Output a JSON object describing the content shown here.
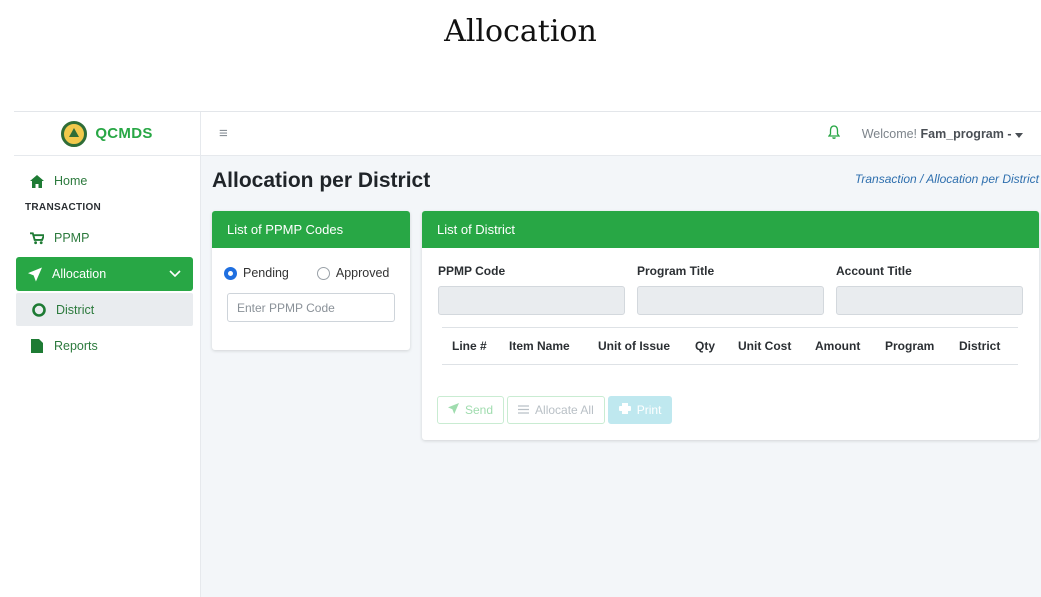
{
  "caption": "Allocation",
  "brand": {
    "name": "QCMDS"
  },
  "sidebar": {
    "home": "Home",
    "section": "TRANSACTION",
    "ppmp": "PPMP",
    "allocation": "Allocation",
    "district": "District",
    "reports": "Reports"
  },
  "topbar": {
    "welcome": "Welcome!",
    "user": "Fam_program -"
  },
  "page": {
    "title": "Allocation per District",
    "breadcrumb": "Transaction / Allocation per District"
  },
  "left_card": {
    "title": "List of PPMP Codes",
    "pending": "Pending",
    "approved": "Approved",
    "selected": "Pending",
    "placeholder": "Enter PPMP Code"
  },
  "right_card": {
    "title": "List of District",
    "fields": [
      "PPMP Code",
      "Program Title",
      "Account Title"
    ],
    "columns": [
      "Line #",
      "Item Name",
      "Unit of Issue",
      "Qty",
      "Unit Cost",
      "Amount",
      "Program",
      "District"
    ],
    "buttons": {
      "send": "Send",
      "allocate": "Allocate All",
      "print": "Print"
    }
  },
  "colors": {
    "accent": "#28a745",
    "breadcrumb": "#2e6fae",
    "radio": "#1f6fe0"
  },
  "icons": [
    "home-icon",
    "cart-icon",
    "paper-plane-icon",
    "chevron-down-icon",
    "circle-icon",
    "file-icon",
    "bell-icon",
    "caret-down-icon",
    "menu-icon",
    "list-icon",
    "print-icon"
  ]
}
